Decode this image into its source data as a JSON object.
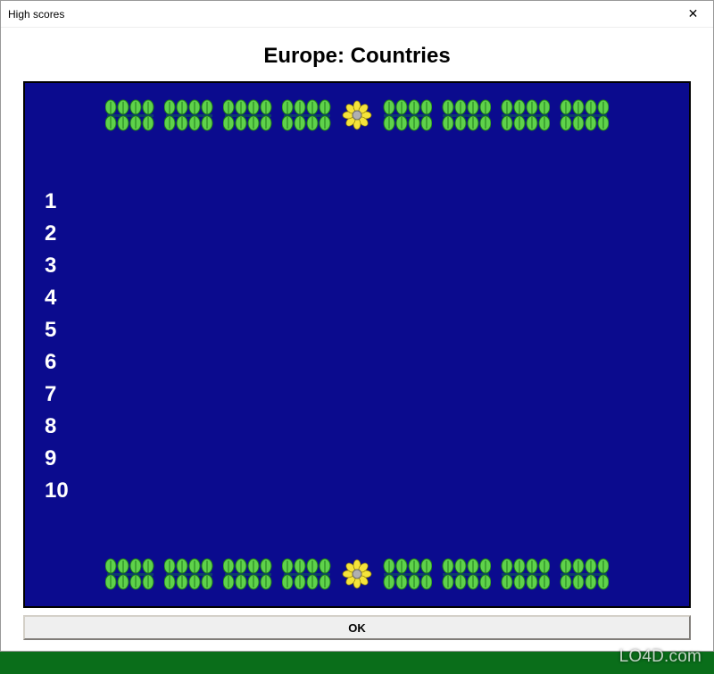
{
  "window": {
    "title": "High scores",
    "close_glyph": "✕"
  },
  "heading": "Europe: Countries",
  "scores": {
    "ranks": [
      "1",
      "2",
      "3",
      "4",
      "5",
      "6",
      "7",
      "8",
      "9",
      "10"
    ]
  },
  "buttons": {
    "ok_label": "OK"
  },
  "decor": {
    "leaf_color_light": "#5fd24b",
    "leaf_color_dark": "#1e7a1a",
    "stem_color": "#0b3e6b",
    "flower_petal": "#f5e33a",
    "flower_center": "#b0b0b0"
  },
  "watermark": "LO4D.com"
}
